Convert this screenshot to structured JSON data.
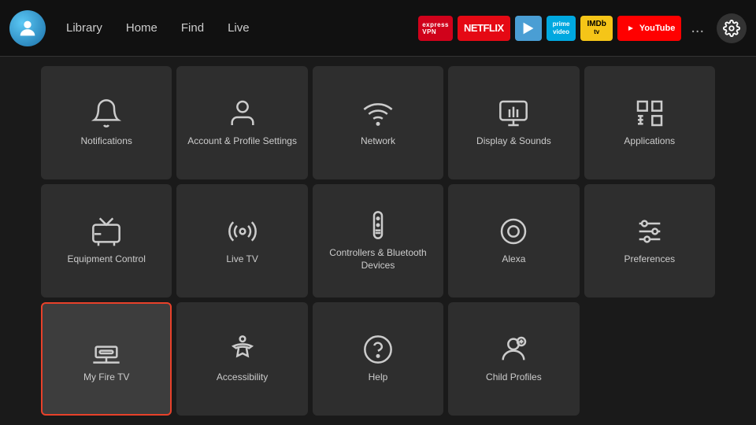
{
  "topnav": {
    "links": [
      "Library",
      "Home",
      "Find",
      "Live"
    ],
    "apps": [
      {
        "id": "expressvpn",
        "label": "Express VPN",
        "class": "app-expressvpn"
      },
      {
        "id": "netflix",
        "label": "NETFLIX",
        "class": "app-netflix"
      },
      {
        "id": "freevee",
        "label": "▶",
        "class": "app-freevee"
      },
      {
        "id": "primevideo",
        "label": "prime video",
        "class": "app-primevideo"
      },
      {
        "id": "imdb",
        "label": "IMDb tv",
        "class": "app-imdb"
      },
      {
        "id": "youtube",
        "label": "▶ YouTube",
        "class": "app-youtube"
      }
    ],
    "more_label": "...",
    "settings_label": "⚙"
  },
  "grid": {
    "items": [
      {
        "id": "notifications",
        "label": "Notifications",
        "icon": "bell"
      },
      {
        "id": "account-profile",
        "label": "Account & Profile Settings",
        "icon": "person"
      },
      {
        "id": "network",
        "label": "Network",
        "icon": "wifi"
      },
      {
        "id": "display-sounds",
        "label": "Display & Sounds",
        "icon": "display"
      },
      {
        "id": "applications",
        "label": "Applications",
        "icon": "apps"
      },
      {
        "id": "equipment-control",
        "label": "Equipment Control",
        "icon": "tv"
      },
      {
        "id": "live-tv",
        "label": "Live TV",
        "icon": "antenna"
      },
      {
        "id": "controllers-bluetooth",
        "label": "Controllers & Bluetooth Devices",
        "icon": "remote"
      },
      {
        "id": "alexa",
        "label": "Alexa",
        "icon": "alexa"
      },
      {
        "id": "preferences",
        "label": "Preferences",
        "icon": "sliders"
      },
      {
        "id": "my-fire-tv",
        "label": "My Fire TV",
        "icon": "firetv",
        "selected": true
      },
      {
        "id": "accessibility",
        "label": "Accessibility",
        "icon": "accessibility"
      },
      {
        "id": "help",
        "label": "Help",
        "icon": "help"
      },
      {
        "id": "child-profiles",
        "label": "Child Profiles",
        "icon": "child-profiles"
      },
      {
        "id": "empty",
        "label": "",
        "icon": "none"
      }
    ]
  }
}
